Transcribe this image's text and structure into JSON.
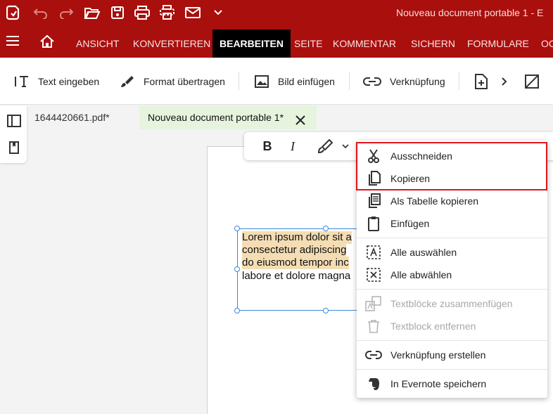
{
  "titlebar": {
    "title": "Nouveau document portable 1   -   E",
    "icons": [
      "app-logo-icon",
      "undo-icon",
      "redo-icon",
      "open-folder-icon",
      "save-icon",
      "print-icon",
      "scan-icon",
      "mail-icon",
      "chevron-down-icon"
    ]
  },
  "menubar": {
    "tabs": [
      "ANSICHT",
      "KONVERTIEREN",
      "BEARBEITEN",
      "SEITE",
      "KOMMENTAR",
      "SICHERN",
      "FORMULARE",
      "OC"
    ],
    "active_tab": "BEARBEITEN"
  },
  "toolbar": {
    "text_input": "Text eingeben",
    "format_paint": "Format übertragen",
    "insert_image": "Bild einfügen",
    "link": "Verknüpfung"
  },
  "doc_tabs": {
    "inactive": "1644420661.pdf*",
    "active": "Nouveau document portable 1*"
  },
  "mini_toolbar": {
    "bold": "B",
    "italic": "I"
  },
  "text_box": {
    "lines": [
      "Lorem ipsum dolor sit a",
      "consectetur adipiscing",
      "do eiusmod tempor inc",
      "labore et dolore magna"
    ]
  },
  "context_menu": {
    "items": [
      {
        "label": "Ausschneiden",
        "icon": "scissors-icon",
        "enabled": true
      },
      {
        "label": "Kopieren",
        "icon": "copy-icon",
        "enabled": true
      },
      {
        "label": "Als Tabelle kopieren",
        "icon": "copy-table-icon",
        "enabled": true
      },
      {
        "label": "Einfügen",
        "icon": "clipboard-icon",
        "enabled": true
      },
      {
        "label": "Alle auswählen",
        "icon": "select-all-icon",
        "enabled": true
      },
      {
        "label": "Alle abwählen",
        "icon": "deselect-all-icon",
        "enabled": true
      },
      {
        "label": "Textblöcke zusammenfügen",
        "icon": "merge-text-icon",
        "enabled": false
      },
      {
        "label": "Textblock entfernen",
        "icon": "trash-icon",
        "enabled": false
      },
      {
        "label": "Verknüpfung erstellen",
        "icon": "link-icon",
        "enabled": true
      },
      {
        "label": "In Evernote speichern",
        "icon": "evernote-icon",
        "enabled": true
      }
    ]
  },
  "colors": {
    "brand": "#a90f0d",
    "active_tab_bg": "#000000",
    "doc_tab_active_bg": "#e6f4de",
    "highlight": "#f4ddb4",
    "selection": "#3c8ad8",
    "red_box": "#e0141b"
  }
}
